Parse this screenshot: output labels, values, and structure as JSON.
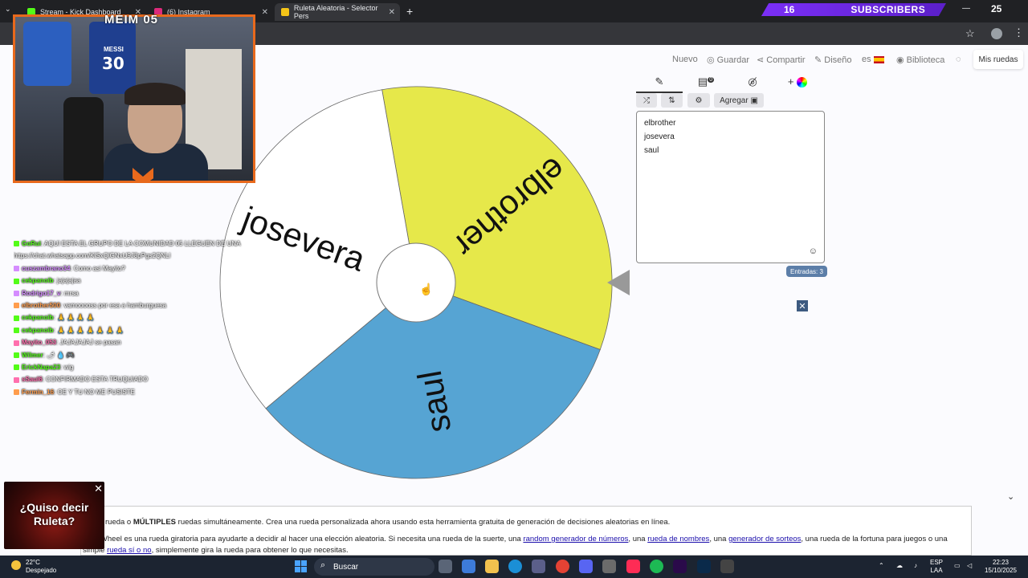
{
  "browser": {
    "tabs": [
      {
        "title": "Stream - Kick Dashboard",
        "icon_color": "#53fc18"
      },
      {
        "title": "(6) Instagram",
        "icon_color": "#dd2a7b"
      },
      {
        "title": "Ruleta Aleatoria - Selector Pers",
        "icon_color": "#f5c518"
      }
    ],
    "new_tab_icon": "plus-icon"
  },
  "stream_overlay": {
    "subscribers_count": "16",
    "subscribers_label": "SUBSCRIBERS",
    "viewer_count": "25",
    "cam_title": "MEIM 05",
    "jersey_number": "30",
    "jersey_name": "MESSI"
  },
  "site_nav": {
    "nuevo": "Nuevo",
    "guardar": "Guardar",
    "compartir": "Compartir",
    "diseno": "Diseño",
    "lang": "es",
    "biblioteca": "Biblioteca",
    "mis_ruedas": "Mis ruedas"
  },
  "wheel": {
    "segments": [
      {
        "label": "elbrother",
        "color": "#e6e84a"
      },
      {
        "label": "josevera",
        "color": "#ffffff"
      },
      {
        "label": "saul",
        "color": "#56a4d3"
      }
    ]
  },
  "panel": {
    "tabs": [
      "pencil-icon",
      "clipboard-icon",
      "eye-off-icon",
      "color-wheel-icon"
    ],
    "clipboard_badge": "0",
    "add_label": "Agregar",
    "entries": [
      "elbrother",
      "josevera",
      "saul"
    ],
    "entries_count_label": "Entradas: 3"
  },
  "chat": [
    {
      "user": "GoRui",
      "msg": "AQUI ESTA EL GRUPO DE LA COMUNIDAD 05 LLEGUEN DE UNA",
      "color": "#53fc18"
    },
    {
      "user": "",
      "msg": "https://chat.whatsapp.com/KlSxQlGNxU9J8pPgs2QNLl",
      "color": "#ffffff"
    },
    {
      "user": "cuszambrano34",
      "msg": "Como asi Mayito?",
      "color": "#d58cff"
    },
    {
      "user": "cekpanoib",
      "msg": "jajajajaa",
      "color": "#53fc18"
    },
    {
      "user": "Rodrigo17_v",
      "msg": "mrsa",
      "color": "#d58cff"
    },
    {
      "user": "elbrother500",
      "msg": "vamooooss por esa a hamburguesa",
      "color": "#ff9d4d"
    },
    {
      "user": "cekpanoib",
      "msg": "🙏 🙏 🙏 🙏",
      "color": "#53fc18"
    },
    {
      "user": "cekpanoib",
      "msg": "🙏 🙏 🙏 🙏 🙏 🙏 🙏",
      "color": "#53fc18"
    },
    {
      "user": "Mayito_053",
      "msg": "JAJAJAJAJ se pasan",
      "color": "#ff6fae"
    },
    {
      "user": "Wilmer",
      "msg": "🌶 💧 🎮",
      "color": "#53fc18"
    },
    {
      "user": "ErickNapa23",
      "msg": "wig",
      "color": "#53fc18"
    },
    {
      "user": "sSaul6",
      "msg": "CONFIRMADO ESTA TRUQUIADO",
      "color": "#ff6fae"
    },
    {
      "user": "Fermin_16",
      "msg": "OE Y TU NO ME PUSISTE",
      "color": "#ff9d4d"
    }
  ],
  "content": {
    "line1_pre": "rueda o ",
    "line1_bold": "MÚLTIPLES",
    "line1_post": " ruedas simultáneamente. Crea una rueda personalizada ahora usando esta herramienta gratuita de generación de decisiones aleatorias en línea.",
    "line2_pre": "e Wheel es una rueda giratoria para ayudarte a decidir al hacer una elección aleatoria. Si necesita una rueda de la suerte, una ",
    "link1": "random generador de números",
    "line2_mid1": ", una ",
    "link2": "rueda de nombres",
    "line2_mid2": ", una ",
    "link3": "generador de sorteos",
    "line2_post": ", una rueda de la fortuna para juegos o una",
    "line3_pre": "simple ",
    "link4": "rueda sí o no",
    "line3_post": ", simplemente gira la rueda para obtener lo que necesitas."
  },
  "ad": {
    "text_line1": "¿Quiso decir",
    "text_line2": "Ruleta?"
  },
  "taskbar": {
    "temperature": "22°C",
    "weather": "Despejado",
    "search_label": "Buscar",
    "lang": "ESP",
    "layout": "LAA",
    "time": "22:23",
    "date": "15/10/2025"
  }
}
